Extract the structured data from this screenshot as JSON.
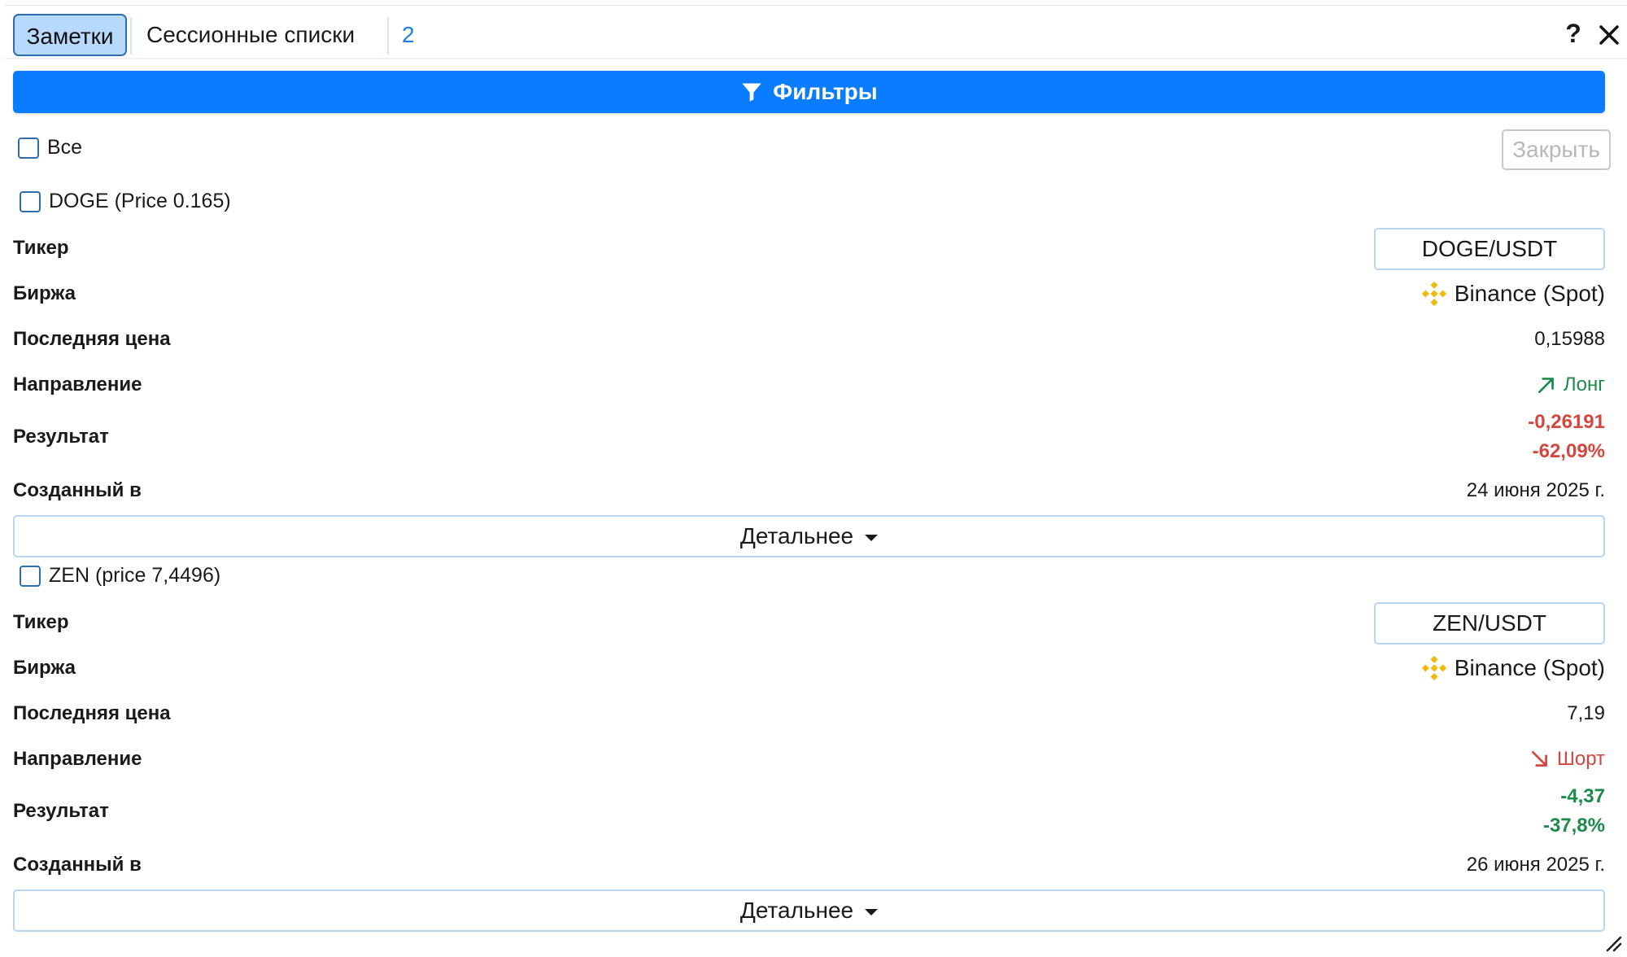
{
  "tabs": {
    "notes": "Заметки",
    "session_lists": "Сессионные списки",
    "count": "2",
    "help": "?"
  },
  "filters": {
    "label": "Фильтры"
  },
  "select_all": {
    "label": "Все"
  },
  "close_button": {
    "label": "Закрыть"
  },
  "labels": {
    "ticker": "Тикер",
    "exchange": "Биржа",
    "last_price": "Последняя цена",
    "direction": "Направление",
    "result": "Результат",
    "created": "Созданный в",
    "details": "Детальнее"
  },
  "trades": [
    {
      "title": "DOGE (Price 0.165)",
      "ticker": "DOGE/USDT",
      "exchange": "Binance (Spot)",
      "last_price": "0,15988",
      "direction": "Лонг",
      "result_value": "-0,26191",
      "result_percent": "-62,09%",
      "created": "24 июня 2025 г."
    },
    {
      "title": "ZEN (price 7,4496)",
      "ticker": "ZEN/USDT",
      "exchange": "Binance (Spot)",
      "last_price": "7,19",
      "direction": "Шорт",
      "result_value": "-4,37",
      "result_percent": "-37,8%",
      "created": "26 июня 2025 г."
    }
  ],
  "colors": {
    "accent": "#0a7cff",
    "long": "#1c8a4a",
    "short": "#d4473f",
    "binance": "#f0b90b"
  },
  "icons": [
    "filter-icon",
    "binance-icon",
    "arrow-up-right-icon",
    "arrow-down-right-icon",
    "close-icon",
    "resize-icon",
    "caret-down-icon"
  ]
}
